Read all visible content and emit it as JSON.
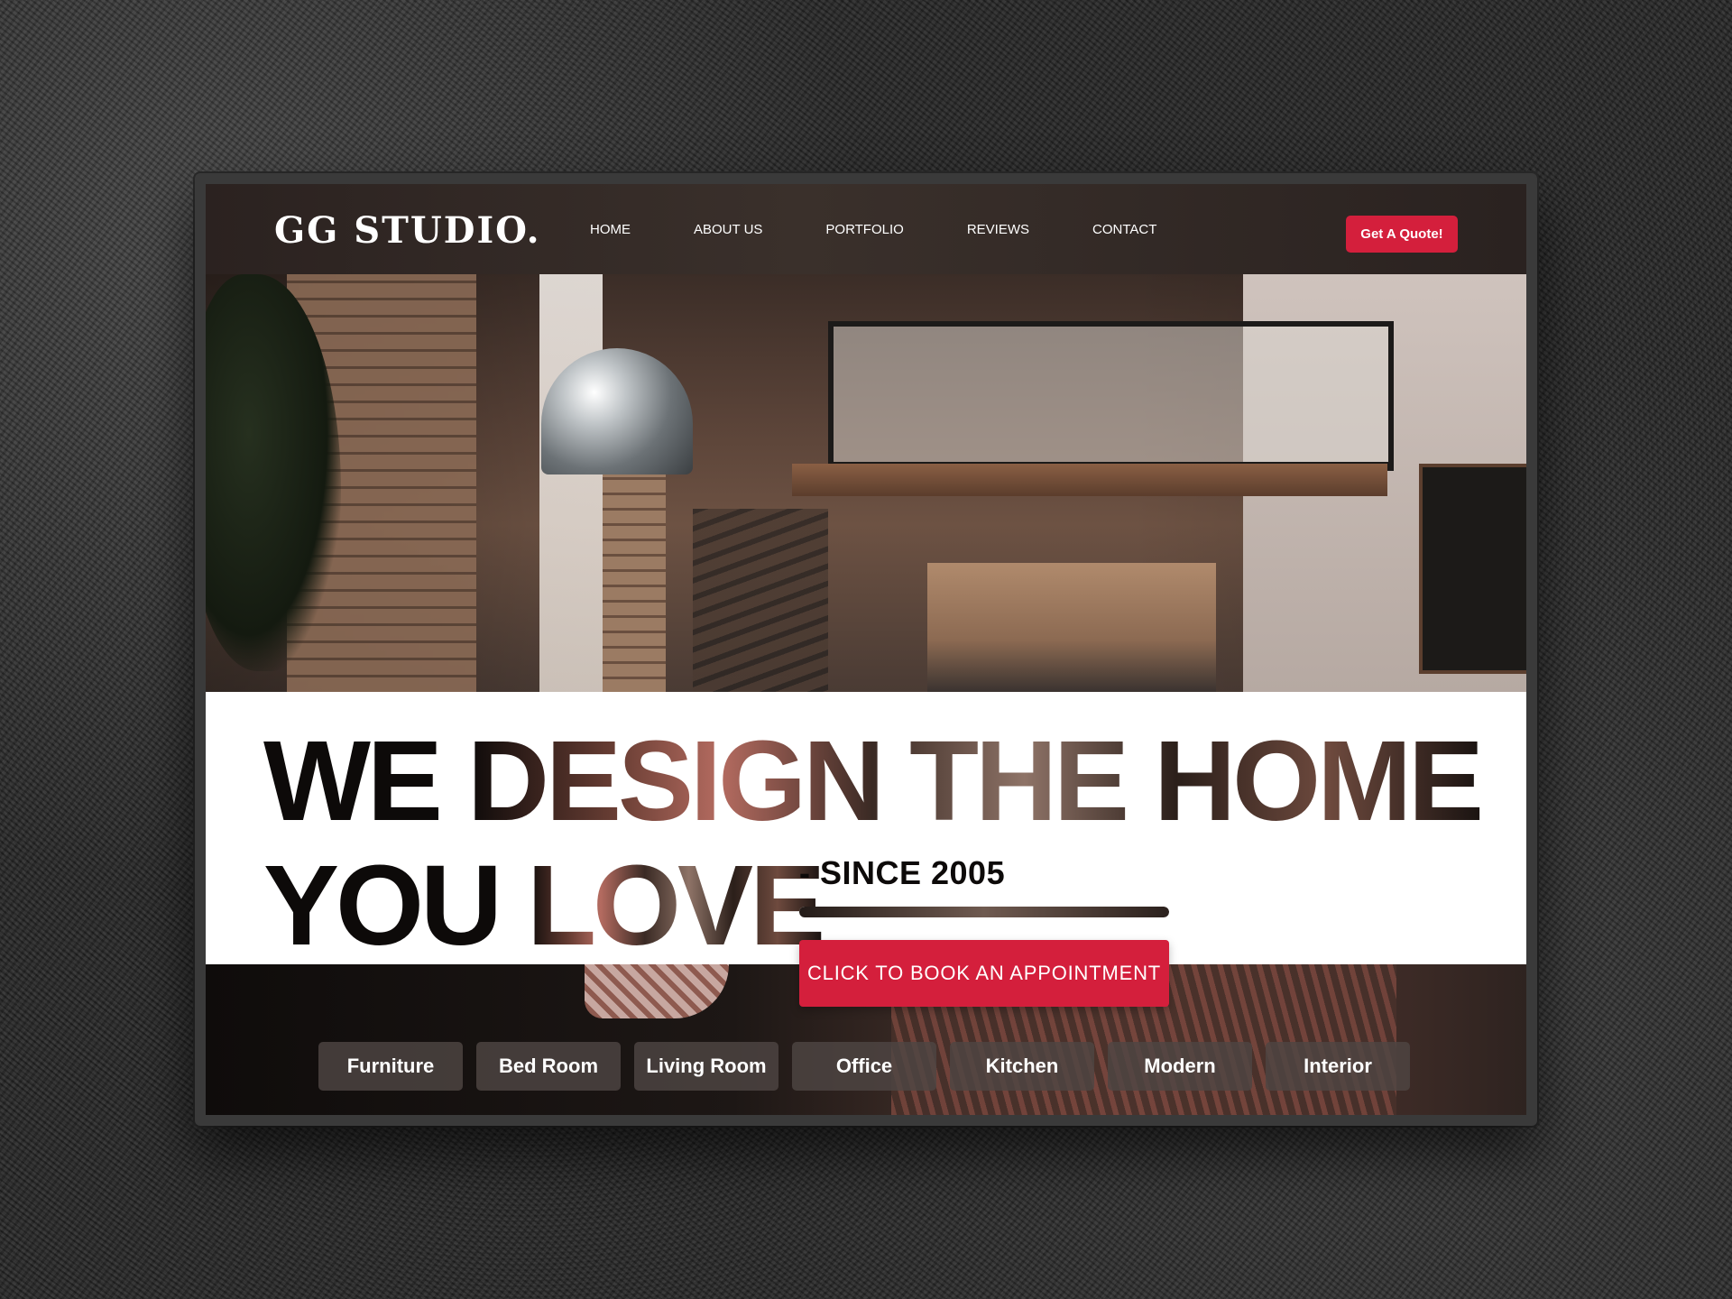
{
  "brand": {
    "logo": "GG STUDIO."
  },
  "nav": {
    "items": [
      {
        "label": "HOME"
      },
      {
        "label": "ABOUT US"
      },
      {
        "label": "PORTFOLIO"
      },
      {
        "label": "REVIEWS"
      },
      {
        "label": "CONTACT"
      }
    ],
    "cta_label": "Get A Quote!"
  },
  "hero": {
    "headline_line1_word1": "WE",
    "headline_line1_rest": "DESIGN THE HOME",
    "headline_line2_word1": "YOU",
    "headline_line2_rest": "LOVE",
    "since": "- SINCE 2005",
    "book_button": "CLICK TO BOOK AN APPOINTMENT"
  },
  "categories": [
    {
      "label": "Furniture"
    },
    {
      "label": "Bed Room"
    },
    {
      "label": "Living Room"
    },
    {
      "label": "Office"
    },
    {
      "label": "Kitchen"
    },
    {
      "label": "Modern"
    },
    {
      "label": "Interior"
    }
  ],
  "colors": {
    "accent": "#d41f3c",
    "header_bg": "#2e2522",
    "pill_bg": "#4e4643",
    "text_dark": "#0d0a09"
  }
}
